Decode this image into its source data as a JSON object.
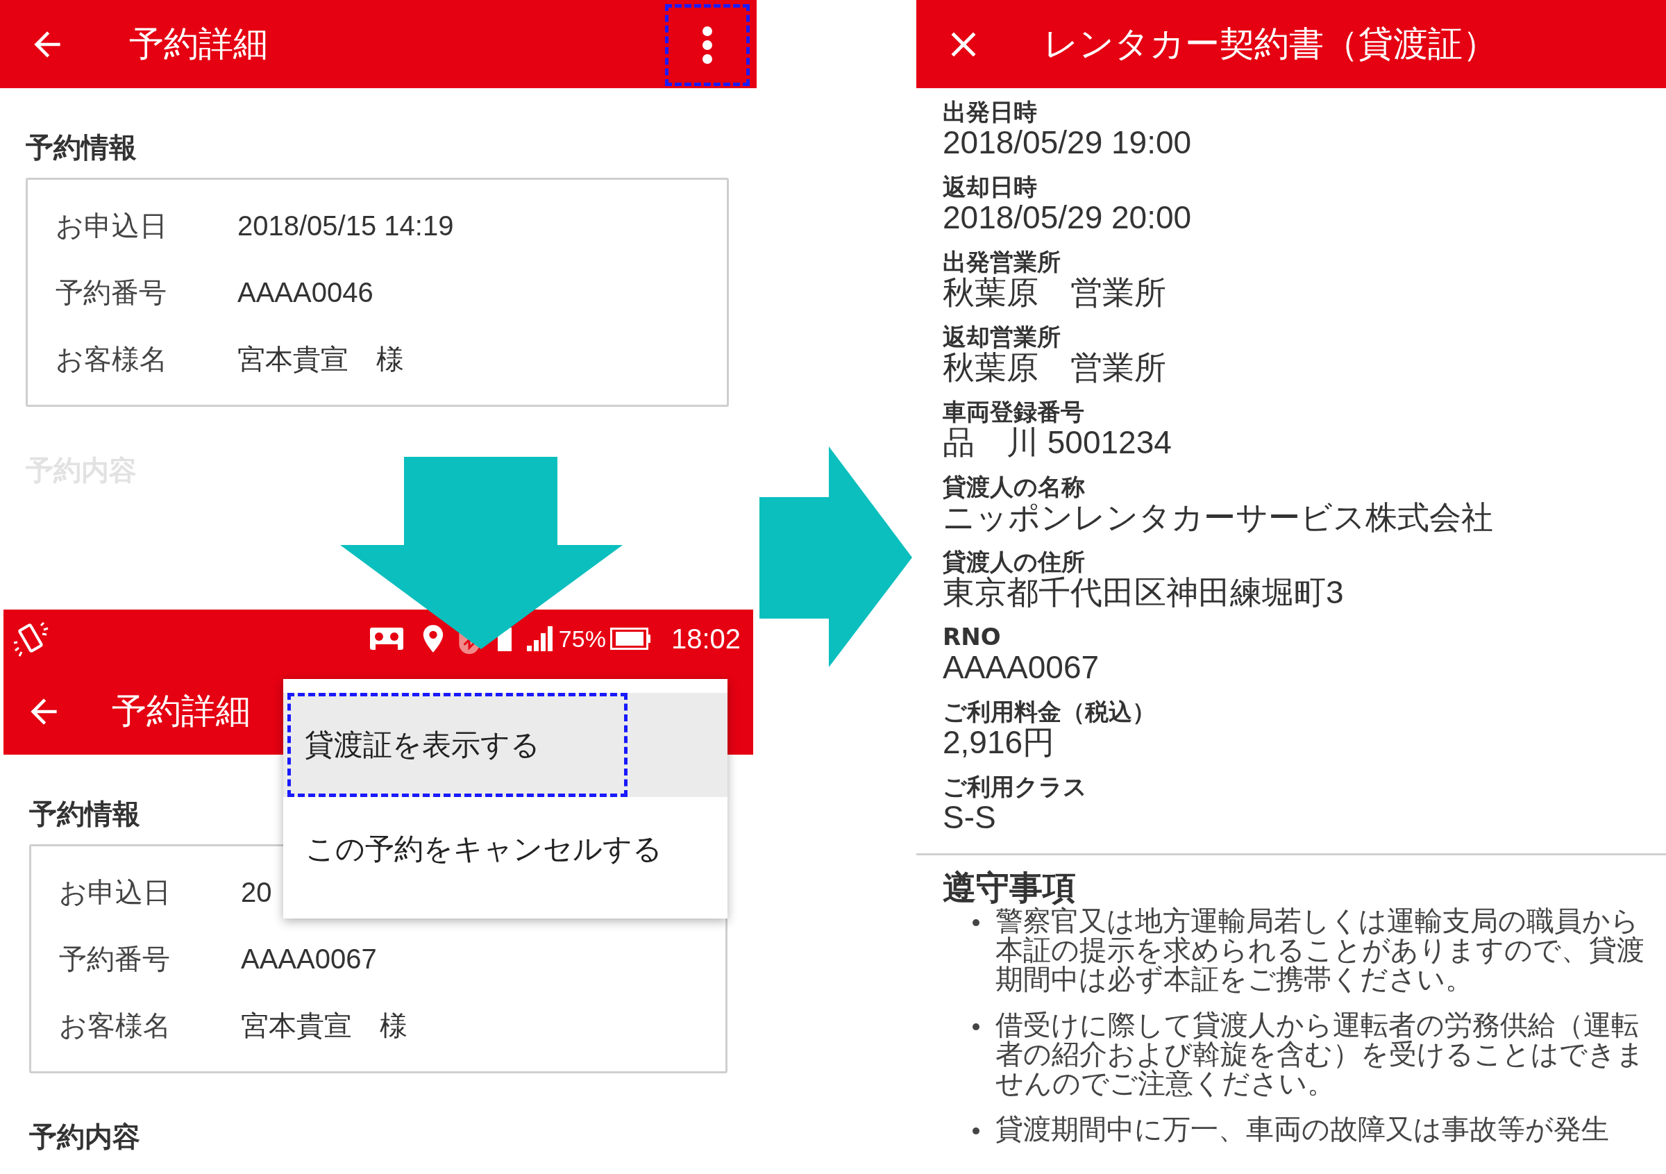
{
  "screen_before": {
    "title": "予約詳細",
    "section": "予約情報",
    "rows": [
      {
        "label": "お申込日",
        "value": "2018/05/15 14:19"
      },
      {
        "label": "予約番号",
        "value": "AAAA0046"
      },
      {
        "label": "お客様名",
        "value": "宮本貴宣　様"
      }
    ],
    "next_section": "予約内容"
  },
  "screen_menu": {
    "status_bar": {
      "battery": "75%",
      "time": "18:02"
    },
    "title": "予約詳細",
    "menu": [
      {
        "label": "貸渡証を表示する",
        "selected": true
      },
      {
        "label": "この予約をキャンセルする",
        "selected": false
      }
    ],
    "section": "予約情報",
    "rows": [
      {
        "label": "お申込日",
        "value": "20"
      },
      {
        "label": "予約番号",
        "value": "AAAA0067"
      },
      {
        "label": "お客様名",
        "value": "宮本貴宣　様"
      }
    ],
    "next_section": "予約内容"
  },
  "certificate": {
    "title": "レンタカー契約書（貸渡証）",
    "fields": [
      {
        "label": "出発日時",
        "value": "2018/05/29 19:00"
      },
      {
        "label": "返却日時",
        "value": "2018/05/29 20:00"
      },
      {
        "label": "出発営業所",
        "value": "秋葉原　営業所"
      },
      {
        "label": "返却営業所",
        "value": "秋葉原　営業所"
      },
      {
        "label": "車両登録番号",
        "value": "品　川 5001234"
      },
      {
        "label": "貸渡人の名称",
        "value": "ニッポンレンタカーサービス株式会社"
      },
      {
        "label": "貸渡人の住所",
        "value": "東京都千代田区神田練堀町3"
      },
      {
        "label": "RNO",
        "value": "AAAA0067"
      },
      {
        "label": "ご利用料金（税込）",
        "value": "2,916円"
      },
      {
        "label": "ご利用クラス",
        "value": "S-S"
      }
    ],
    "rules_title": "遵守事項",
    "rules": [
      "警察官又は地方運輸局若しくは運輸支局の職員から本証の提示を求められることがありますので、貸渡期間中は必ず本証をご携帯ください。",
      "借受けに際して貸渡人から運転者の労務供給（運転者の紹介および斡旋を含む）を受けることはできませんのでご注意ください。",
      "貸渡期間中に万一、車両の故障又は事故等が発生"
    ]
  }
}
